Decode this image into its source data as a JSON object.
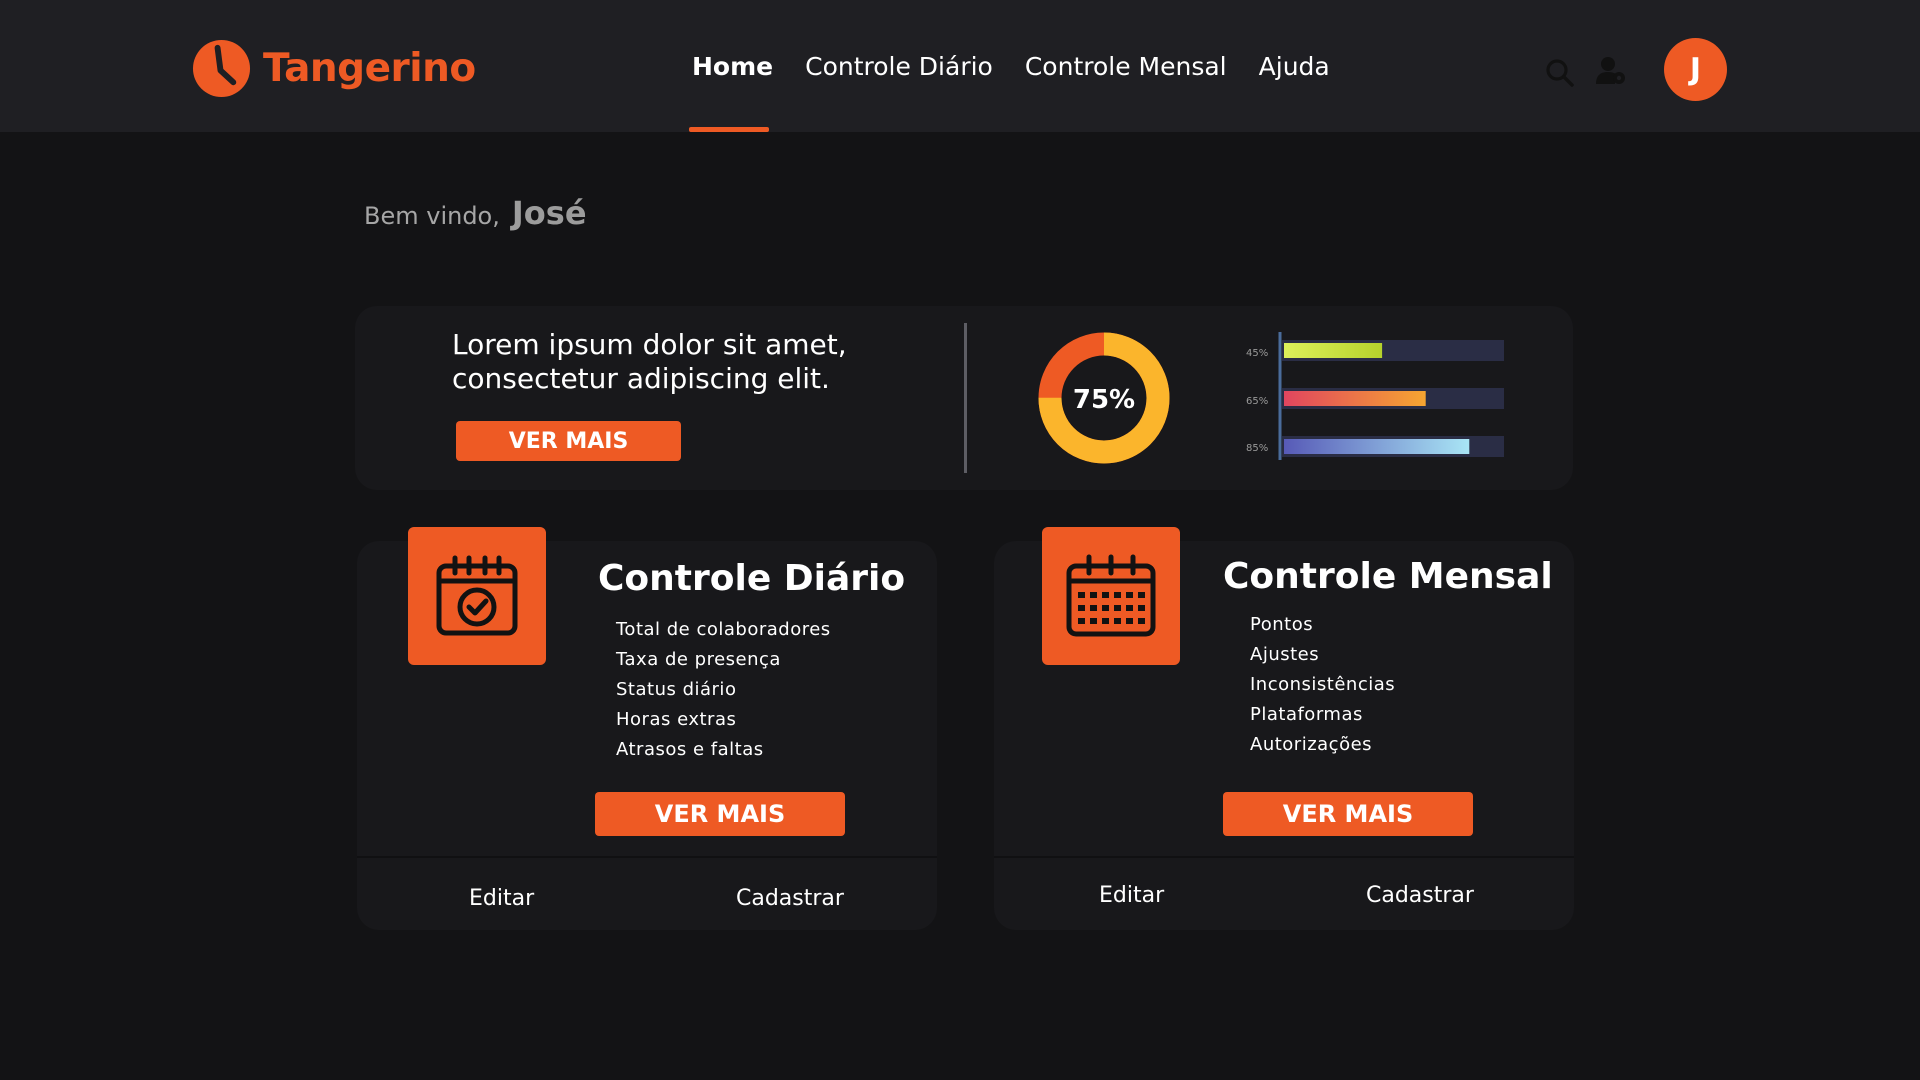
{
  "app": {
    "name": "Tangerino",
    "brand_color": "#ee5a24"
  },
  "nav": {
    "items": [
      "Home",
      "Controle Diário",
      "Controle Mensal",
      "Ajuda"
    ],
    "active": "Home"
  },
  "header_icons": [
    "search-icon",
    "user-settings-icon"
  ],
  "user": {
    "initial": "J"
  },
  "welcome": {
    "label": "Bem vindo,",
    "name": "José"
  },
  "summary": {
    "text": "Lorem ipsum dolor sit amet, consectetur adipiscing elit.",
    "button": "VER MAIS",
    "donut": {
      "label": "75%",
      "value": 0.75,
      "colors": [
        "#fbb52c",
        "#ee5a24"
      ]
    },
    "bars": [
      {
        "label": "45%",
        "value": 0.45,
        "colors": [
          "#ddf05a",
          "#b6d22c"
        ]
      },
      {
        "label": "65%",
        "value": 0.65,
        "colors": [
          "#e1455f",
          "#f6a531"
        ]
      },
      {
        "label": "85%",
        "value": 0.85,
        "colors": [
          "#575ab7",
          "#a9e5f5"
        ]
      }
    ]
  },
  "cards": [
    {
      "title": "Controle Diário",
      "icon": "calendar-check-icon",
      "items": [
        "Total de colaboradores",
        "Taxa de presença",
        "Status diário",
        "Horas extras",
        "Atrasos e faltas"
      ],
      "button": "VER MAIS",
      "actions": [
        "Editar",
        "Cadastrar"
      ]
    },
    {
      "title": "Controle Mensal",
      "icon": "calendar-grid-icon",
      "items": [
        "Pontos",
        "Ajustes",
        "Inconsistências",
        "Plataformas",
        "Autorizações"
      ],
      "button": "VER MAIS",
      "actions": [
        "Editar",
        "Cadastrar"
      ]
    }
  ]
}
